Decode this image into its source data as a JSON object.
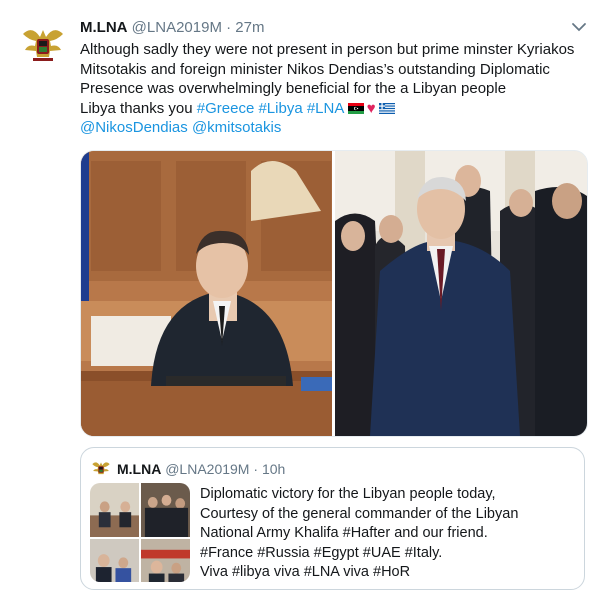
{
  "tweet": {
    "display_name": "M.LNA",
    "handle": "@LNA2019M",
    "separator": "·",
    "time": "27m",
    "lines": [
      "Although sadly they were not present in person but prime minster Kyriakos",
      "Mitsotakis and foreign minister Nikos Dendias’s outstanding Diplomatic",
      "Presence was overwhelmingly beneficial for the a Libyan people"
    ],
    "thanks_text": "Libya thanks you ",
    "hashtags": [
      "#Greece",
      "#Libya",
      "#LNA"
    ],
    "mentions": [
      "@NikosDendias",
      "@kmitsotakis"
    ],
    "emoji": [
      "libya-flag",
      "red-heart",
      "greece-flag"
    ],
    "heart_glyph": "♥"
  },
  "quoted": {
    "display_name": "M.LNA",
    "handle": "@LNA2019M",
    "separator": "·",
    "time": "10h",
    "lines": [
      "Diplomatic victory for the Libyan people today,",
      "Courtesy of the general commander of the Libyan",
      "National Army Khalifa #Hafter and our friend.",
      "#France #Russia #Egypt #UAE #Italy.",
      "Viva #libya viva #LNA viva #HoR"
    ]
  },
  "colors": {
    "text": "#14171a",
    "secondary": "#657786",
    "link": "#1b95e0",
    "heart": "#e0245e",
    "border": "#ccd6dd"
  },
  "icons": [
    "lna-emblem-avatar",
    "chevron-down-icon"
  ]
}
